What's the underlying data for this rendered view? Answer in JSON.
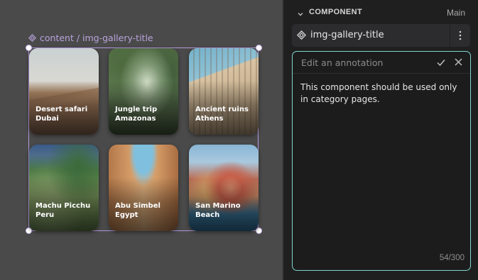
{
  "canvas": {
    "selection_label": "content / img-gallery-title",
    "cards": [
      {
        "line1": "Desert safari",
        "line2": "Dubai",
        "photo": "desert-photo"
      },
      {
        "line1": "Jungle trip",
        "line2": "Amazonas",
        "photo": "jungle-photo"
      },
      {
        "line1": "Ancient ruins",
        "line2": "Athens",
        "photo": "ruins-photo"
      },
      {
        "line1": "Machu Picchu",
        "line2": "Peru",
        "photo": "machu-picchu-photo"
      },
      {
        "line1": "Abu Simbel",
        "line2": "Egypt",
        "photo": "abu-simbel-photo"
      },
      {
        "line1": "San Marino",
        "line2": "Beach",
        "photo": "san-marino-photo"
      }
    ]
  },
  "panel": {
    "section_title": "COMPONENT",
    "section_right": "Main",
    "component_name": "img-gallery-title",
    "annotation": {
      "header": "Edit an annotation",
      "text": "This component should be used only in category pages.",
      "counter": "54/300"
    }
  },
  "colors": {
    "canvas_bg": "#4a4a4a",
    "panel_bg": "#1f1f20",
    "selection": "#b69ae0",
    "annotation_border": "#7fd6cc"
  },
  "icons": [
    "component-diamond-icon",
    "chevron-down-icon",
    "kebab-menu-icon",
    "check-icon",
    "close-icon"
  ]
}
